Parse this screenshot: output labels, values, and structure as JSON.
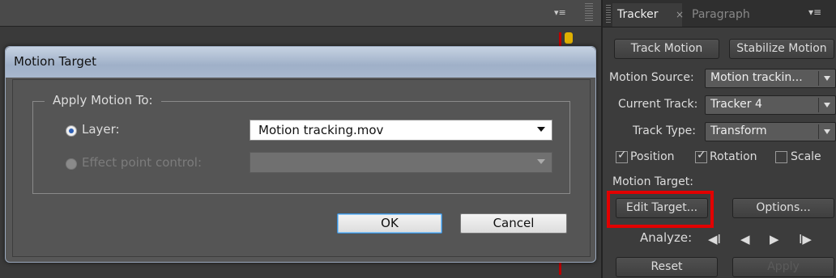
{
  "dialog": {
    "title": "Motion Target",
    "group_label": "Apply Motion To:",
    "layer_label": "Layer:",
    "layer_value": "Motion tracking.mov",
    "effect_label": "Effect point control:",
    "effect_value": "",
    "ok_label": "OK",
    "cancel_label": "Cancel"
  },
  "panel": {
    "tabs": [
      "Tracker",
      "Paragraph"
    ],
    "close_glyph": "×",
    "menu_glyph": "▾≡",
    "track_motion_label": "Track Motion",
    "stabilize_motion_label": "Stabilize Motion",
    "motion_source_label": "Motion Source:",
    "motion_source_value": "Motion trackin...",
    "current_track_label": "Current Track:",
    "current_track_value": "Tracker 4",
    "track_type_label": "Track Type:",
    "track_type_value": "Transform",
    "position_label": "Position",
    "position_checked": true,
    "rotation_label": "Rotation",
    "rotation_checked": true,
    "scale_label": "Scale",
    "scale_checked": false,
    "motion_target_label": "Motion Target:",
    "edit_target_label": "Edit Target...",
    "options_label": "Options...",
    "analyze_label": "Analyze:",
    "analyze_controls": [
      "◀I",
      "◀",
      "▶",
      "I▶"
    ],
    "reset_label": "Reset",
    "apply_label": "Apply"
  },
  "comp": {
    "menu_glyph": "▾≡"
  },
  "colors": {
    "highlight": "#e20000",
    "default_button_border": "#3c8fd8"
  },
  "icons": [
    "panel-menu-icon",
    "checkmark-icon",
    "dropdown-arrow-icon",
    "analyze-back-icon",
    "analyze-play-icon"
  ]
}
